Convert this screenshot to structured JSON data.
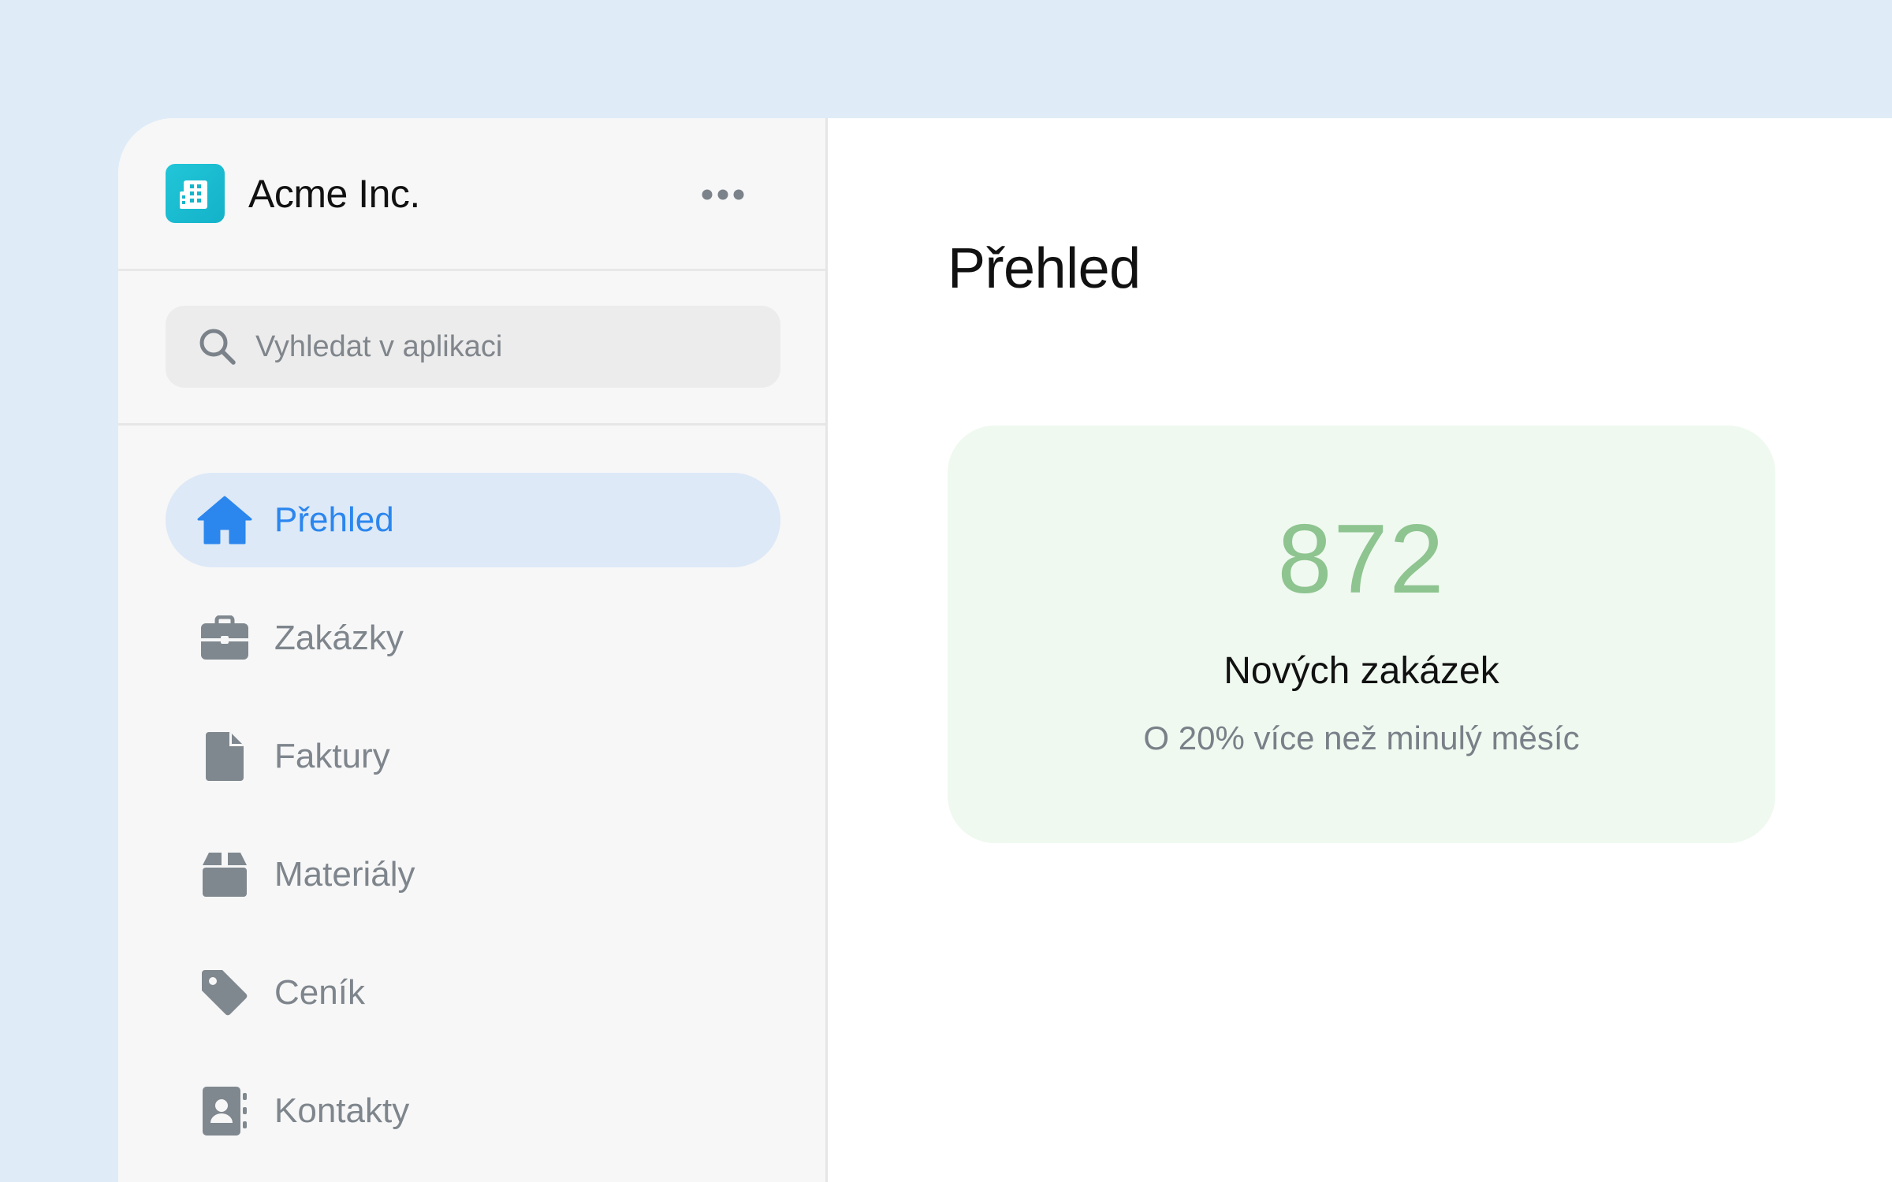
{
  "brand": {
    "name": "Acme Inc.",
    "logo_icon": "building-icon",
    "logo_color": "#1dbfd3"
  },
  "header": {
    "more_icon": "more-horizontal-icon"
  },
  "search": {
    "placeholder": "Vyhledat v aplikaci",
    "icon": "search-icon"
  },
  "sidebar": {
    "items": [
      {
        "label": "Přehled",
        "icon": "home-icon",
        "active": true
      },
      {
        "label": "Zakázky",
        "icon": "briefcase-icon",
        "active": false
      },
      {
        "label": "Faktury",
        "icon": "file-icon",
        "active": false
      },
      {
        "label": "Materiály",
        "icon": "box-icon",
        "active": false
      },
      {
        "label": "Ceník",
        "icon": "tag-icon",
        "active": false
      },
      {
        "label": "Kontakty",
        "icon": "address-book-icon",
        "active": false
      }
    ]
  },
  "main": {
    "title": "Přehled",
    "stat": {
      "value": "872",
      "label": "Nových zakázek",
      "subtext": "O 20% více než minulý měsíc"
    }
  },
  "colors": {
    "accent": "#2b86ee",
    "active_bg": "#dde9f7",
    "stat_green": "#8ec48f",
    "card_bg": "#eff9f0",
    "icon_gray": "#80888f"
  }
}
